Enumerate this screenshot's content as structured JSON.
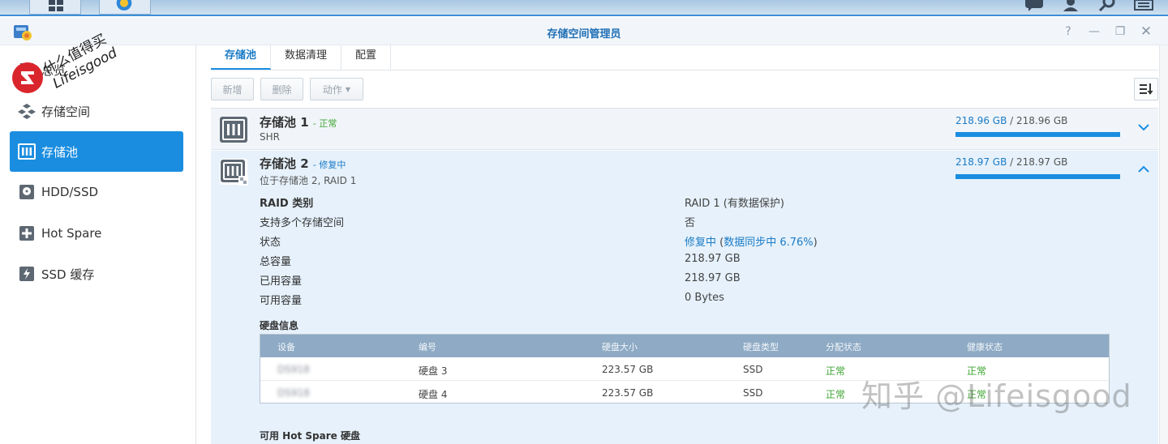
{
  "window": {
    "title": "存储空间管理员"
  },
  "sidebar": {
    "items": [
      {
        "label": "总览",
        "icon": "overview-icon"
      },
      {
        "label": "存储空间",
        "icon": "volume-icon"
      },
      {
        "label": "存储池",
        "icon": "storage-pool-icon",
        "active": true
      },
      {
        "label": "HDD/SSD",
        "icon": "disk-icon"
      },
      {
        "label": "Hot Spare",
        "icon": "hot-spare-icon"
      },
      {
        "label": "SSD 缓存",
        "icon": "ssd-cache-icon"
      }
    ]
  },
  "tabs": [
    {
      "label": "存储池",
      "active": true
    },
    {
      "label": "数据清理"
    },
    {
      "label": "配置"
    }
  ],
  "toolbar": {
    "add_label": "新增",
    "delete_label": "删除",
    "action_label": "动作"
  },
  "pools": [
    {
      "name": "存储池 1",
      "status": "- 正常",
      "status_color": "#3fa535",
      "sub": "SHR",
      "used": "218.96 GB",
      "total": "/ 218.96 GB",
      "fill_fraction": 1.0
    },
    {
      "name": "存储池 2",
      "status": "- 修复中",
      "status_color": "#1a7bc6",
      "sub": "位于存储池 2, RAID 1",
      "used": "218.97 GB",
      "total": "/ 218.97 GB",
      "fill_fraction": 1.0
    }
  ],
  "details": [
    {
      "label": "RAID 类别",
      "value": "RAID 1 (有数据保护)"
    },
    {
      "label": "支持多个存储空间",
      "value": "否"
    },
    {
      "label": "状态",
      "value_link": "修复中",
      "value_open": " (",
      "value_link2": "数据同步中 6.76%",
      "value_close": ")"
    },
    {
      "label": "总容量",
      "value": "218.97 GB"
    },
    {
      "label": "已用容量",
      "value": "218.97 GB"
    },
    {
      "label": "可用容量",
      "value": "0 Bytes"
    }
  ],
  "disk_info": {
    "title": "硬盘信息",
    "headers": [
      "设备",
      "编号",
      "硬盘大小",
      "硬盘类型",
      "分配状态",
      "健康状态"
    ],
    "rows": [
      {
        "device": "DS918",
        "id": "硬盘 3",
        "size": "223.57 GB",
        "type": "SSD",
        "alloc": "正常",
        "health": "正常"
      },
      {
        "device": "DS918",
        "id": "硬盘 4",
        "size": "223.57 GB",
        "type": "SSD",
        "alloc": "正常",
        "health": "正常"
      }
    ]
  },
  "hot_spare_title": "可用 Hot Spare 硬盘",
  "watermarks": {
    "zhihu": "知乎 @Lifeisgood",
    "smzdm_top": "什么值得买",
    "smzdm_bottom": "Lifeisgood"
  },
  "colors": {
    "accent": "#1a8de0",
    "ok": "#3fa535"
  }
}
